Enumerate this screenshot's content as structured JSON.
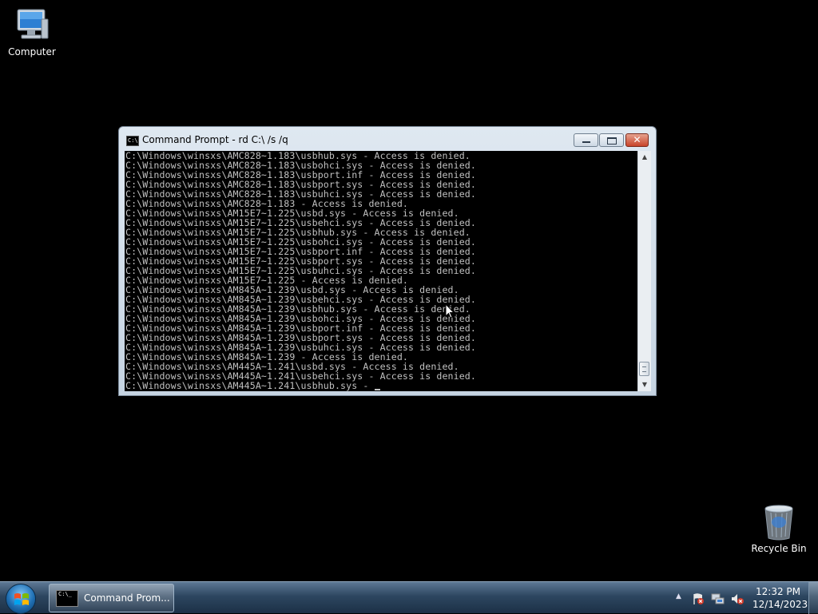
{
  "desktop": {
    "icons": [
      {
        "label": "Computer"
      },
      {
        "label": "Recycle Bin"
      }
    ]
  },
  "window": {
    "title": "Command Prompt - rd  C:\\ /s /q",
    "icon_text": "C:\\",
    "close_symbol": "✕",
    "lines": [
      "C:\\Windows\\winsxs\\AMC828~1.183\\usbhub.sys - Access is denied.",
      "C:\\Windows\\winsxs\\AMC828~1.183\\usbohci.sys - Access is denied.",
      "C:\\Windows\\winsxs\\AMC828~1.183\\usbport.inf - Access is denied.",
      "C:\\Windows\\winsxs\\AMC828~1.183\\usbport.sys - Access is denied.",
      "C:\\Windows\\winsxs\\AMC828~1.183\\usbuhci.sys - Access is denied.",
      "C:\\Windows\\winsxs\\AMC828~1.183 - Access is denied.",
      "C:\\Windows\\winsxs\\AM15E7~1.225\\usbd.sys - Access is denied.",
      "C:\\Windows\\winsxs\\AM15E7~1.225\\usbehci.sys - Access is denied.",
      "C:\\Windows\\winsxs\\AM15E7~1.225\\usbhub.sys - Access is denied.",
      "C:\\Windows\\winsxs\\AM15E7~1.225\\usbohci.sys - Access is denied.",
      "C:\\Windows\\winsxs\\AM15E7~1.225\\usbport.inf - Access is denied.",
      "C:\\Windows\\winsxs\\AM15E7~1.225\\usbport.sys - Access is denied.",
      "C:\\Windows\\winsxs\\AM15E7~1.225\\usbuhci.sys - Access is denied.",
      "C:\\Windows\\winsxs\\AM15E7~1.225 - Access is denied.",
      "C:\\Windows\\winsxs\\AM845A~1.239\\usbd.sys - Access is denied.",
      "C:\\Windows\\winsxs\\AM845A~1.239\\usbehci.sys - Access is denied.",
      "C:\\Windows\\winsxs\\AM845A~1.239\\usbhub.sys - Access is denied.",
      "C:\\Windows\\winsxs\\AM845A~1.239\\usbohci.sys - Access is denied.",
      "C:\\Windows\\winsxs\\AM845A~1.239\\usbport.inf - Access is denied.",
      "C:\\Windows\\winsxs\\AM845A~1.239\\usbport.sys - Access is denied.",
      "C:\\Windows\\winsxs\\AM845A~1.239\\usbuhci.sys - Access is denied.",
      "C:\\Windows\\winsxs\\AM845A~1.239 - Access is denied.",
      "C:\\Windows\\winsxs\\AM445A~1.241\\usbd.sys - Access is denied.",
      "C:\\Windows\\winsxs\\AM445A~1.241\\usbehci.sys - Access is denied.",
      "C:\\Windows\\winsxs\\AM445A~1.241\\usbhub.sys - "
    ]
  },
  "taskbar": {
    "task_label": "Command Prom...",
    "task_icon_text": "C:\\_",
    "clock_time": "12:32 PM",
    "clock_date": "12/14/2023",
    "tray_up_arrow": "▲"
  },
  "colors": {
    "desktop_bg": "#000000",
    "console_fg": "#c0c0c0",
    "close_red": "#c8432a"
  }
}
